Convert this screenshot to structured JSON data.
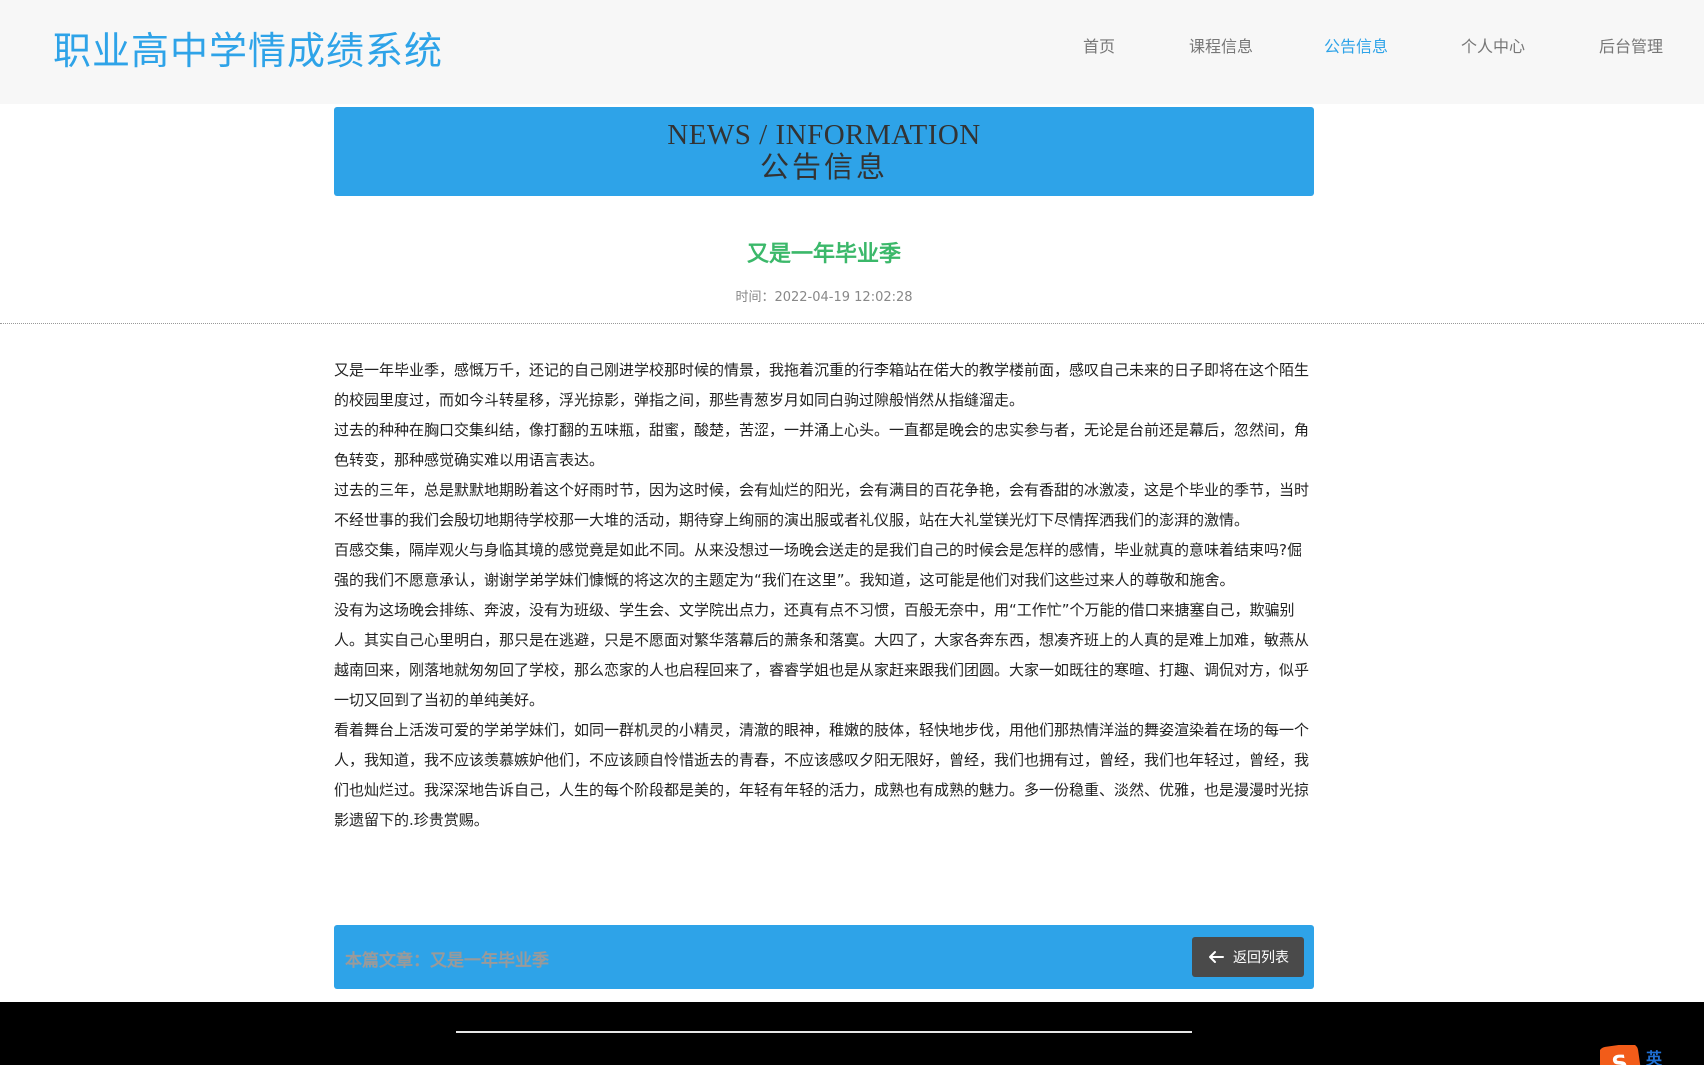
{
  "header": {
    "site_title": "职业高中学情成绩系统",
    "nav": [
      {
        "label": "首页"
      },
      {
        "label": "课程信息"
      },
      {
        "label": "公告信息",
        "active": true
      },
      {
        "label": "个人中心"
      },
      {
        "label": "后台管理"
      }
    ]
  },
  "banner": {
    "title_en": "NEWS / INFORMATION",
    "title_cn": "公告信息"
  },
  "article": {
    "title": "又是一年毕业季",
    "time_label": "时间：",
    "time_value": "2022-04-19 12:02:28",
    "paragraphs": [
      "又是一年毕业季，感慨万千，还记的自己刚进学校那时候的情景，我拖着沉重的行李箱站在偌大的教学楼前面，感叹自己未来的日子即将在这个陌生的校园里度过，而如今斗转星移，浮光掠影，弹指之间，那些青葱岁月如同白驹过隙般悄然从指缝溜走。",
      "过去的种种在胸口交集纠结，像打翻的五味瓶，甜蜜，酸楚，苦涩，一并涌上心头。一直都是晚会的忠实参与者，无论是台前还是幕后，忽然间，角色转变，那种感觉确实难以用语言表达。",
      "过去的三年，总是默默地期盼着这个好雨时节，因为这时候，会有灿烂的阳光，会有满目的百花争艳，会有香甜的冰激凌，这是个毕业的季节，当时不经世事的我们会殷切地期待学校那一大堆的活动，期待穿上绚丽的演出服或者礼仪服，站在大礼堂镁光灯下尽情挥洒我们的澎湃的激情。",
      "百感交集，隔岸观火与身临其境的感觉竟是如此不同。从来没想过一场晚会送走的是我们自己的时候会是怎样的感情，毕业就真的意味着结束吗?倔强的我们不愿意承认，谢谢学弟学妹们慷慨的将这次的主题定为“我们在这里”。我知道，这可能是他们对我们这些过来人的尊敬和施舍。",
      "没有为这场晚会排练、奔波，没有为班级、学生会、文学院出点力，还真有点不习惯，百般无奈中，用“工作忙”个万能的借口来搪塞自己，欺骗别人。其实自己心里明白，那只是在逃避，只是不愿面对繁华落幕后的萧条和落寞。大四了，大家各奔东西，想凑齐班上的人真的是难上加难，敏燕从越南回来，刚落地就匆匆回了学校，那么恋家的人也启程回来了，睿睿学姐也是从家赶来跟我们团圆。大家一如既往的寒暄、打趣、调侃对方，似乎一切又回到了当初的单纯美好。",
      "看着舞台上活泼可爱的学弟学妹们，如同一群机灵的小精灵，清澈的眼神，稚嫩的肢体，轻快地步伐，用他们那热情洋溢的舞姿渲染着在场的每一个人，我知道，我不应该羡慕嫉妒他们，不应该顾自怜惜逝去的青春，不应该感叹夕阳无限好，曾经，我们也拥有过，曾经，我们也年轻过，曾经，我们也灿烂过。我深深地告诉自己，人生的每个阶段都是美的，年轻有年轻的活力，成熟也有成熟的魅力。多一份稳重、淡然、优雅，也是漫漫时光掠影遗留下的.珍贵赏赐。"
    ]
  },
  "footer_bar": {
    "current_prefix": "本篇文章：",
    "current_title": "又是一年毕业季",
    "back_label": "返回列表"
  },
  "ime": {
    "logo": "S",
    "label": "英"
  },
  "colors": {
    "accent": "#2ea3e8",
    "title_green": "#3bb86a",
    "back_button": "#4a4a4a"
  }
}
